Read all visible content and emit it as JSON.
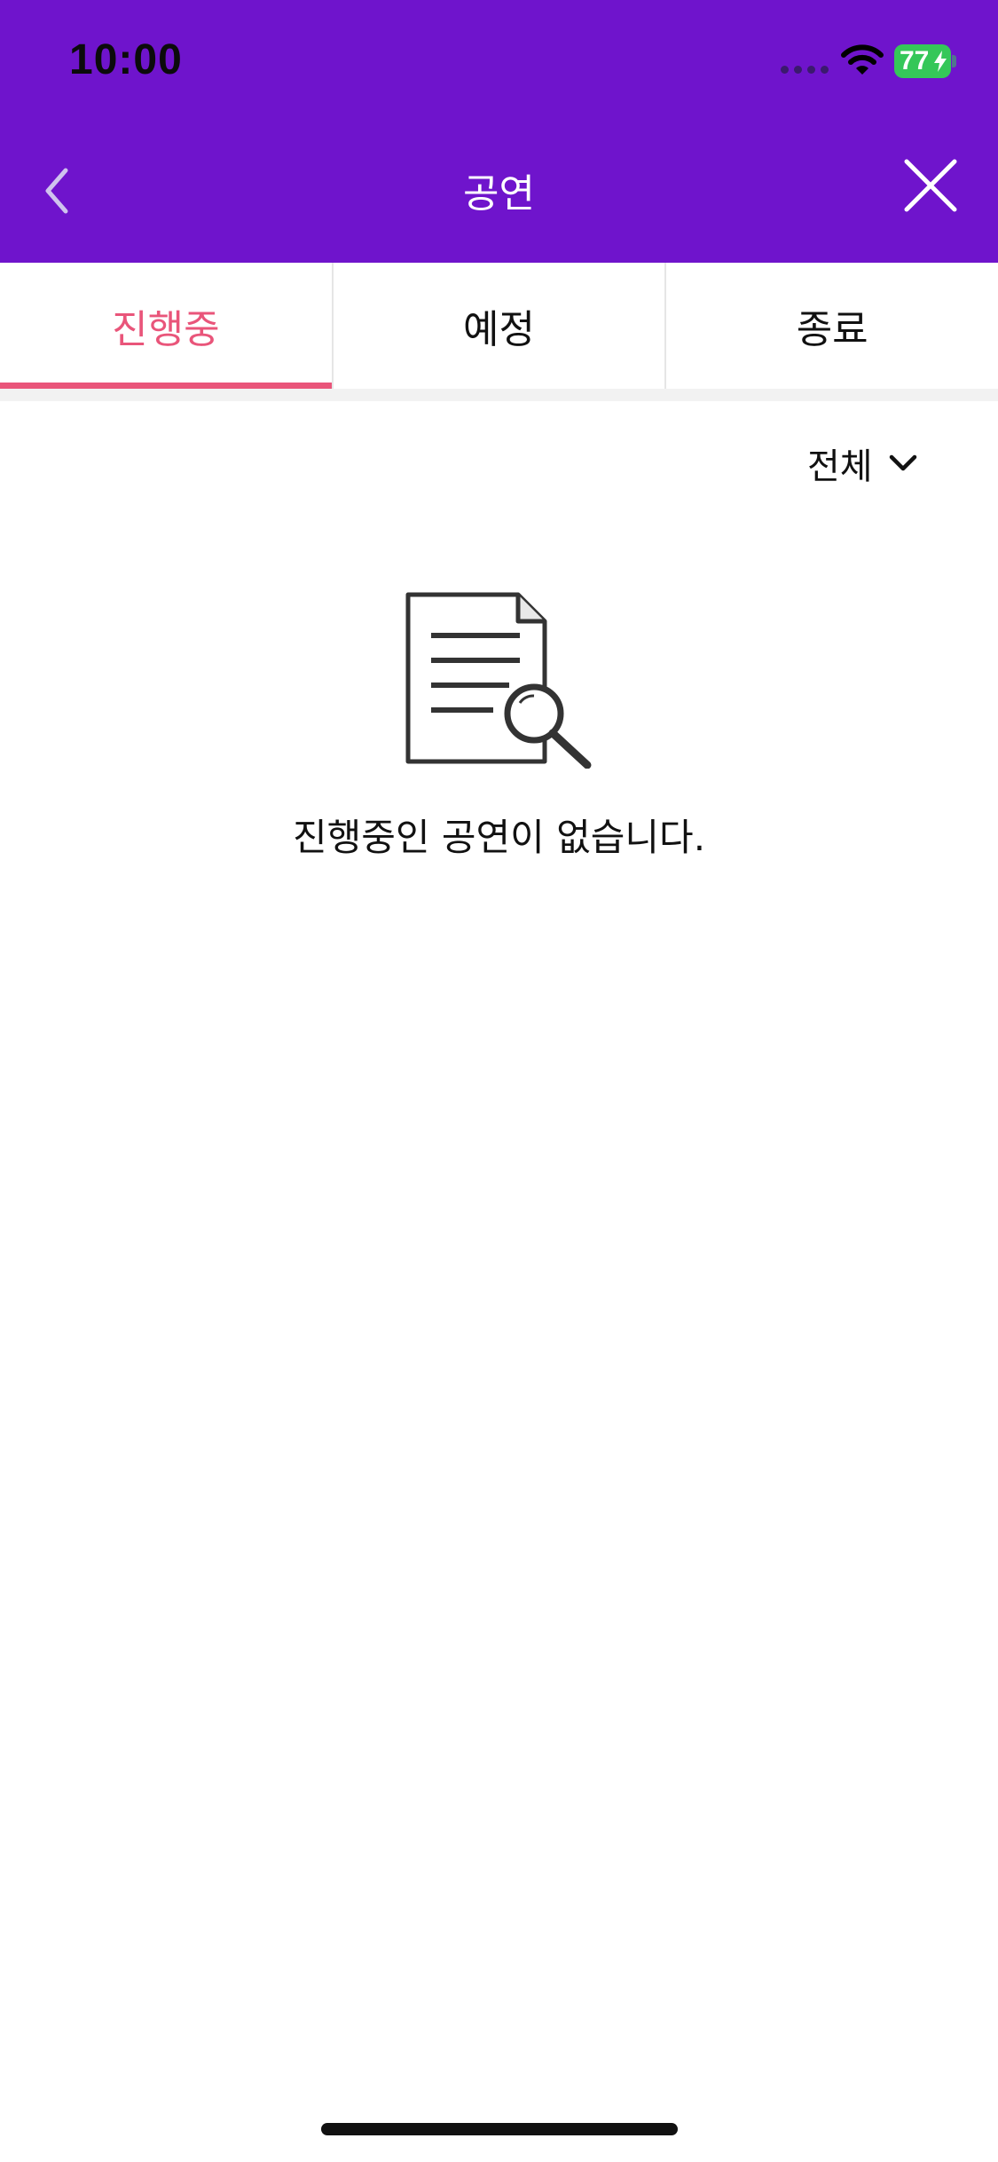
{
  "status_bar": {
    "time": "10:00",
    "battery_percent": "77",
    "icons": [
      "signal-dots-icon",
      "wifi-icon",
      "battery-icon",
      "charging-bolt-icon"
    ]
  },
  "nav": {
    "title": "공연",
    "back_icon": "chevron-left-icon",
    "close_icon": "close-icon"
  },
  "tabs": [
    {
      "label": "진행중",
      "active": true
    },
    {
      "label": "예정",
      "active": false
    },
    {
      "label": "종료",
      "active": false
    }
  ],
  "filter": {
    "selected": "전체",
    "icon": "chevron-down-icon"
  },
  "empty_state": {
    "icon": "document-search-icon",
    "message": "진행중인 공연이 없습니다."
  },
  "colors": {
    "header_bg": "#6F14CC",
    "accent": "#E9557A",
    "battery": "#35C759"
  }
}
